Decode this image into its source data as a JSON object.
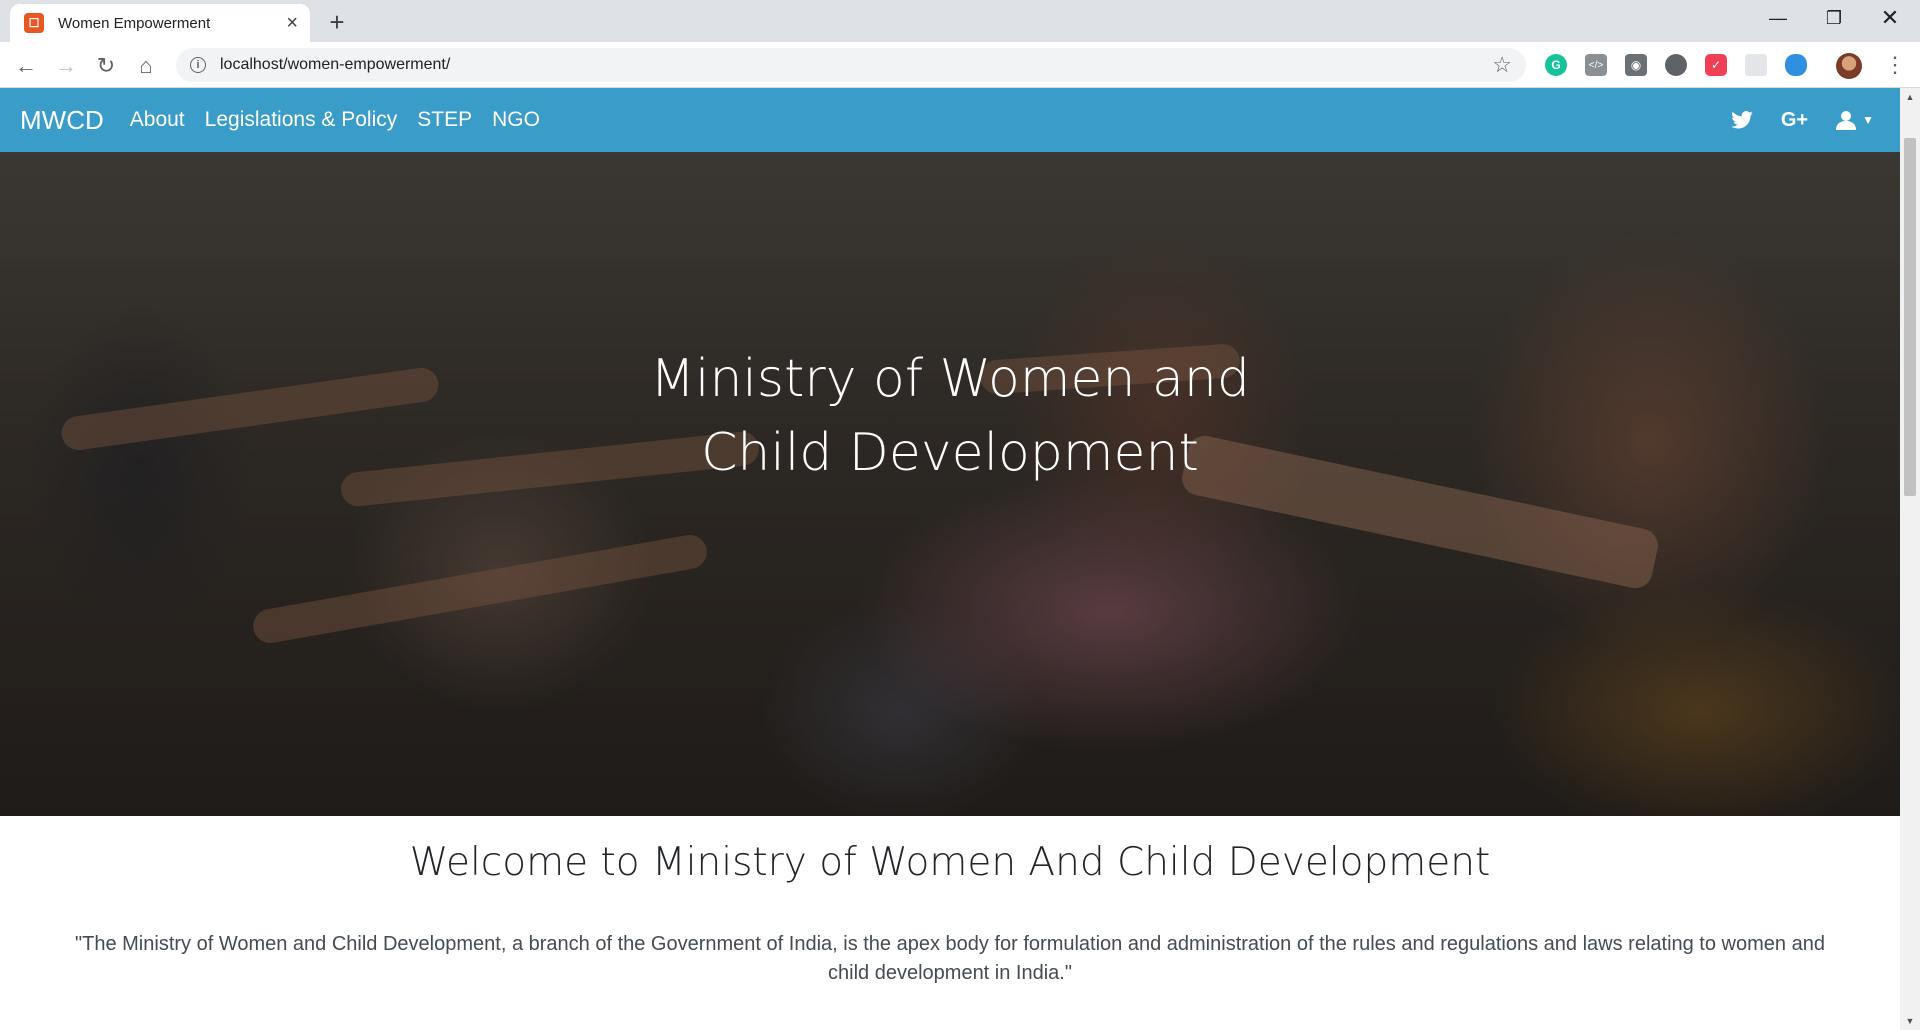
{
  "browser": {
    "tab_title": "Women Empowerment",
    "url": "localhost/women-empowerment/"
  },
  "site": {
    "brand": "MWCD",
    "nav": [
      "About",
      "Legislations & Policy",
      "STEP",
      "NGO"
    ],
    "social_icons": [
      "twitter-icon",
      "google-plus-icon",
      "user-icon"
    ],
    "accent_color": "#3a9cc8"
  },
  "hero": {
    "title": "Ministry of Women and Child Development"
  },
  "content": {
    "welcome": "Welcome to Ministry of Women And Child Development",
    "quote": "\"The Ministry of Women and Child Development, a branch of the Government of India, is the apex body for formulation and administration of the rules and regulations and laws relating to women and child development in India.\""
  }
}
